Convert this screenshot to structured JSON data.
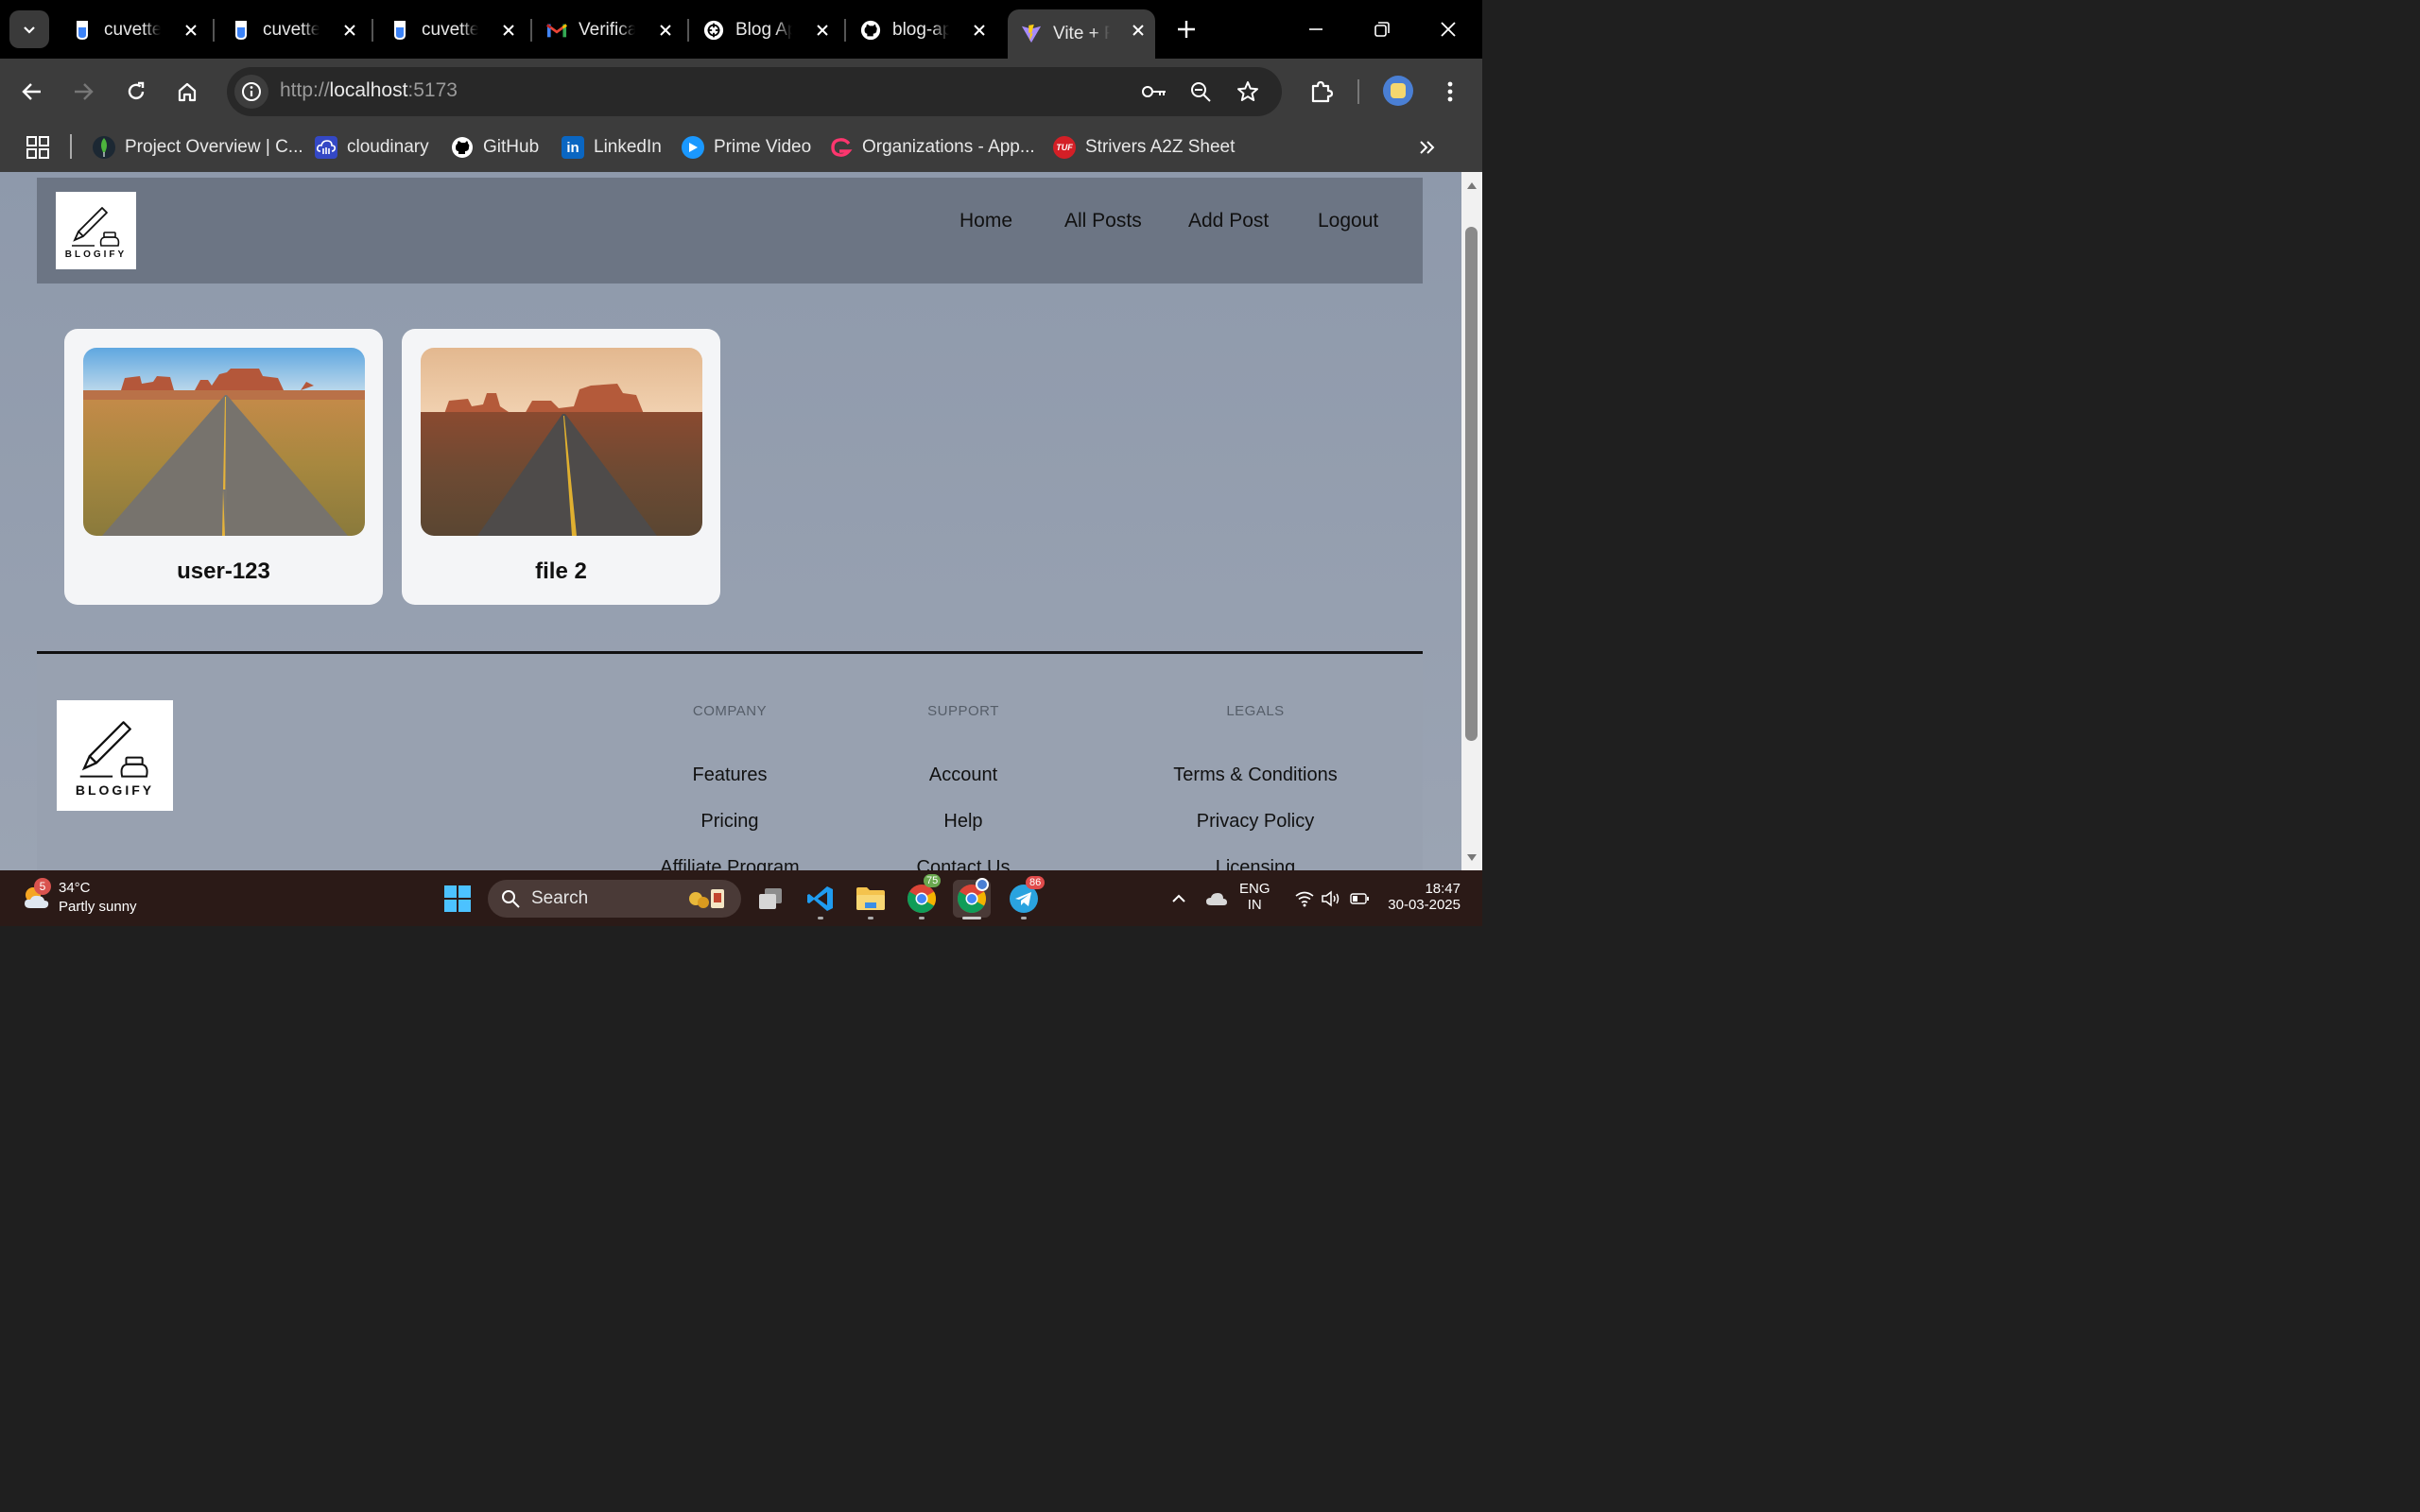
{
  "browser": {
    "tabs": [
      {
        "title": "cuvette",
        "icon": "cuvette-icon"
      },
      {
        "title": "cuvette",
        "icon": "cuvette-icon"
      },
      {
        "title": "cuvette",
        "icon": "cuvette-icon"
      },
      {
        "title": "Verifica",
        "icon": "gmail-icon"
      },
      {
        "title": "Blog Ap",
        "icon": "chatgpt-icon"
      },
      {
        "title": "blog-ap",
        "icon": "github-icon"
      },
      {
        "title": "Vite + R",
        "icon": "vite-icon",
        "active": true
      }
    ],
    "url_scheme": "http://",
    "url_host": "localhost",
    "url_port": ":5173",
    "bookmarks": [
      {
        "label": "Project Overview | C...",
        "icon": "mongodb-icon"
      },
      {
        "label": "cloudinary",
        "icon": "cloudinary-icon"
      },
      {
        "label": "GitHub",
        "icon": "github-icon"
      },
      {
        "label": "LinkedIn",
        "icon": "linkedin-icon"
      },
      {
        "label": "Prime Video",
        "icon": "prime-video-icon"
      },
      {
        "label": "Organizations - App...",
        "icon": "appwrite-icon"
      },
      {
        "label": "Strivers A2Z Sheet",
        "icon": "tuf-icon"
      }
    ],
    "tuf_logo_text": "TUF"
  },
  "site": {
    "logo_text": "BLOGIFY",
    "nav": [
      "Home",
      "All Posts",
      "Add Post",
      "Logout"
    ],
    "posts": [
      {
        "title": "user-123"
      },
      {
        "title": "file 2"
      }
    ],
    "footer": {
      "columns": [
        {
          "heading": "COMPANY",
          "links": [
            "Features",
            "Pricing",
            "Affiliate Program"
          ]
        },
        {
          "heading": "SUPPORT",
          "links": [
            "Account",
            "Help",
            "Contact Us"
          ]
        },
        {
          "heading": "LEGALS",
          "links": [
            "Terms & Conditions",
            "Privacy Policy",
            "Licensing"
          ]
        }
      ]
    }
  },
  "taskbar": {
    "weather_temp": "34°C",
    "weather_desc": "Partly sunny",
    "weather_badge": "5",
    "search_placeholder": "Search",
    "chrome_badge": "75",
    "telegram_badge": "86",
    "lang_1": "ENG",
    "lang_2": "IN",
    "time": "18:47",
    "date": "30-03-2025"
  }
}
